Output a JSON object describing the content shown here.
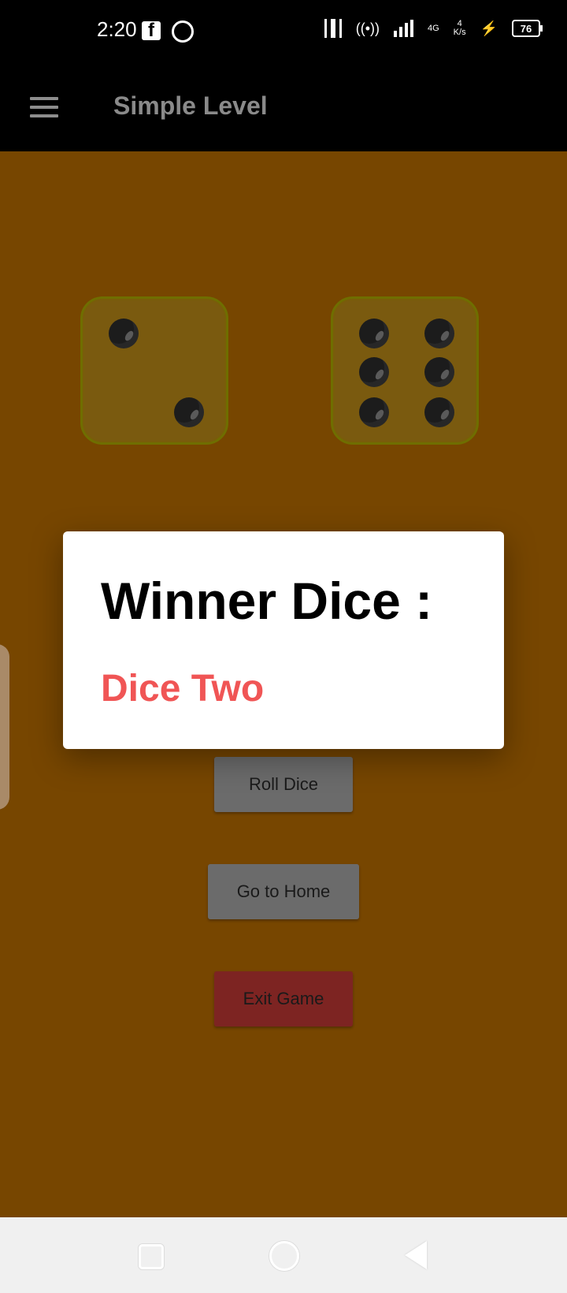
{
  "status_bar": {
    "time": "2:20",
    "network": "4G",
    "speed_value": "4",
    "speed_unit": "K/s",
    "battery": "76"
  },
  "app_bar": {
    "title": "Simple Level"
  },
  "dice": [
    {
      "name": "dice-one",
      "value": 2
    },
    {
      "name": "dice-two",
      "value": 6
    }
  ],
  "dialog": {
    "title": "Winner Dice :",
    "winner": "Dice Two",
    "winner_color": "#f05555"
  },
  "buttons": {
    "roll": "Roll Dice",
    "home": "Go to Home",
    "exit": "Exit Game"
  },
  "colors": {
    "background": "#774600",
    "app_bar": "#000000",
    "exit_button": "#7d2422",
    "neutral_button": "#6b6b6b"
  }
}
